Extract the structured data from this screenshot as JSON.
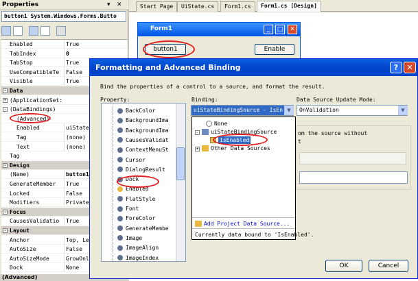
{
  "properties_panel": {
    "title": "Properties",
    "object": "button1 System.Windows.Forms.Butto",
    "rows": [
      {
        "name": "Enabled",
        "value": "True"
      },
      {
        "name": "TabIndex",
        "value": "0",
        "bold": true
      },
      {
        "name": "TabStop",
        "value": "True"
      },
      {
        "name": "UseCompatibleTe",
        "value": "False"
      },
      {
        "name": "Visible",
        "value": "True"
      },
      {
        "name": "Data",
        "category": true
      },
      {
        "name": "(ApplicationSet:",
        "value": "",
        "expander": "+"
      },
      {
        "name": "(DataBindings)",
        "value": "",
        "expander": "-"
      },
      {
        "name": "(Advanced)",
        "value": "",
        "indent": true
      },
      {
        "name": "Enabled",
        "value": "uiStateBi",
        "indent": true
      },
      {
        "name": "Tag",
        "value": "(none)",
        "indent": true
      },
      {
        "name": "Text",
        "value": "(none)",
        "indent": true
      },
      {
        "name": "Tag",
        "value": ""
      },
      {
        "name": "Design",
        "category": true
      },
      {
        "name": "(Name)",
        "value": "button1",
        "bold": true
      },
      {
        "name": "GenerateMember",
        "value": "True"
      },
      {
        "name": "Locked",
        "value": "False"
      },
      {
        "name": "Modifiers",
        "value": "Private"
      },
      {
        "name": "Focus",
        "category": true
      },
      {
        "name": "CausesValidatio",
        "value": "True"
      },
      {
        "name": "Layout",
        "category": true
      },
      {
        "name": "Anchor",
        "value": "Top, Lef"
      },
      {
        "name": "AutoSize",
        "value": "False"
      },
      {
        "name": "AutoSizeMode",
        "value": "GrowOnly"
      },
      {
        "name": "Dock",
        "value": "None"
      }
    ],
    "status": "(Advanced)"
  },
  "tabs": [
    {
      "label": "Start Page",
      "active": false
    },
    {
      "label": "UiState.cs",
      "active": false
    },
    {
      "label": "Form1.cs",
      "active": false
    },
    {
      "label": "Form1.cs [Design]",
      "active": true
    }
  ],
  "form1": {
    "title": "Form1",
    "button1_label": "button1",
    "enable_label": "Enable"
  },
  "dialog": {
    "title": "Formatting and Advanced Binding",
    "instructions": "Bind the properties of a control to a source, and format the result.",
    "property_label": "Property:",
    "binding_label": "Binding:",
    "update_mode_label": "Data Source Update Mode:",
    "properties": [
      "BackColor",
      "BackgroundIma",
      "BackgroundIma",
      "CausesValidat",
      "ContextMenuSt",
      "Cursor",
      "DialogResult",
      "Dock",
      "Enabled",
      "FlatStyle",
      "Font",
      "ForeColor",
      "GenerateMembe",
      "Image",
      "ImageAlign",
      "ImageIndex"
    ],
    "selected_property": "Enabled",
    "binding_value": "uiStateBindingSource - IsEn",
    "update_mode_value": "OnValidation",
    "tree": {
      "none": "None",
      "source": "uiStateBindingSource",
      "selected": "IsEnabled",
      "other": "Other Data Sources"
    },
    "add_source": "Add Project Data Source...",
    "current_binding": "Currently data bound to 'IsEnabled'.",
    "hint_fragment_1": "om the source without",
    "hint_fragment_2": "t",
    "ok": "OK",
    "cancel": "Cancel"
  },
  "colors": {
    "titlebar": "#0054e3",
    "highlight": "#316ac5",
    "annotation": "#e02020"
  }
}
